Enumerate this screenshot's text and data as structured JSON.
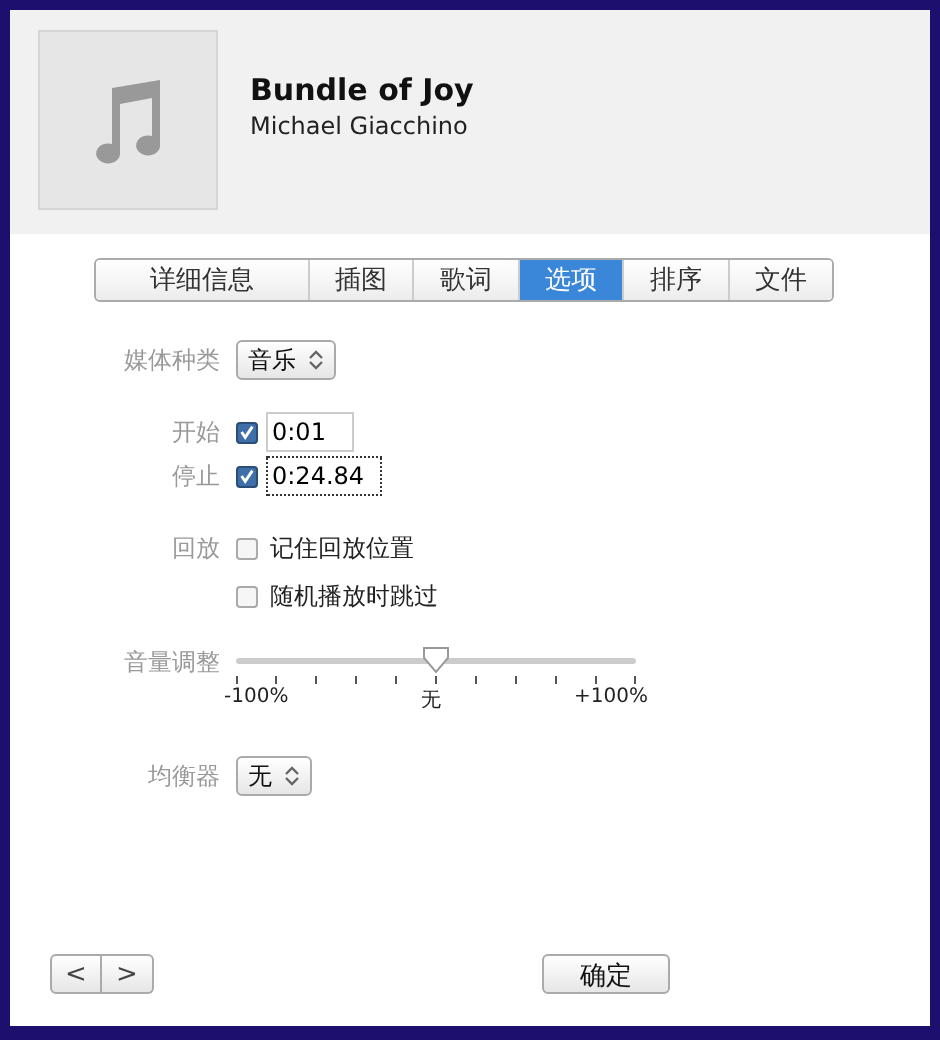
{
  "track": {
    "title": "Bundle of Joy",
    "artist": "Michael Giacchino"
  },
  "tabs": [
    {
      "label": "详细信息",
      "selected": false
    },
    {
      "label": "插图",
      "selected": false
    },
    {
      "label": "歌词",
      "selected": false
    },
    {
      "label": "选项",
      "selected": true
    },
    {
      "label": "排序",
      "selected": false
    },
    {
      "label": "文件",
      "selected": false
    }
  ],
  "media_kind": {
    "label": "媒体种类",
    "value": "音乐"
  },
  "start": {
    "label": "开始",
    "checked": true,
    "value": "0:01"
  },
  "stop": {
    "label": "停止",
    "checked": true,
    "value": "0:24.84"
  },
  "playback": {
    "label": "回放",
    "options": [
      {
        "label": "记住回放位置",
        "checked": false
      },
      {
        "label": "随机播放时跳过",
        "checked": false
      }
    ]
  },
  "volume": {
    "label": "音量调整",
    "level": 0.5,
    "min_label": "-100%",
    "mid_label": "无",
    "max_label": "+100%"
  },
  "equalizer": {
    "label": "均衡器",
    "value": "无"
  },
  "nav": {
    "prev": "<",
    "next": ">"
  },
  "ok_button": "确定"
}
